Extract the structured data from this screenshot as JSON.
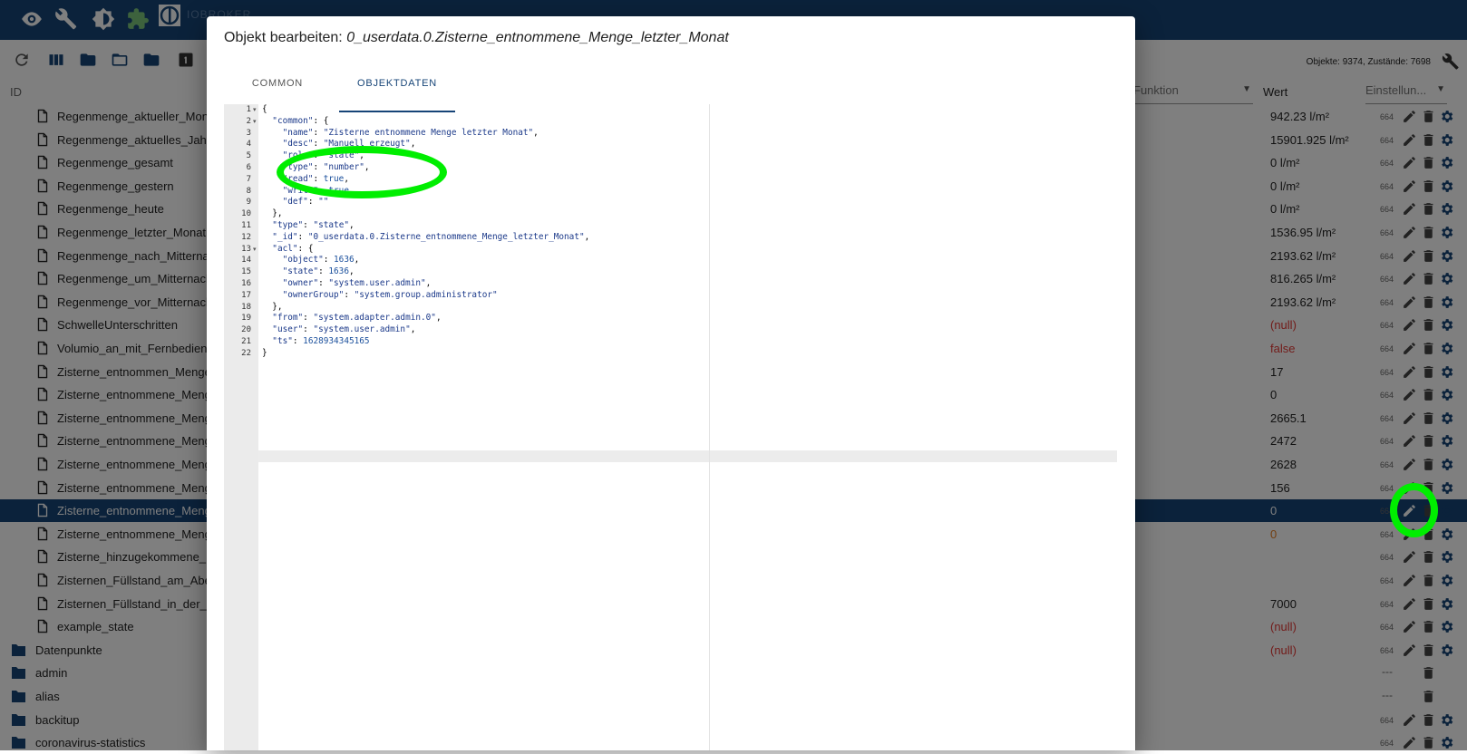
{
  "appbar": {
    "brand": "IOBROKER",
    "icons": [
      "eye-icon",
      "wrench-icon",
      "brightness-icon",
      "puzzle-icon",
      "iobroker-logo-icon"
    ]
  },
  "toolbar": {
    "stats": "Objekte: 9374, Zustände: 7698",
    "icons": [
      "refresh-icon",
      "columns-icon",
      "folder-icon",
      "folder-open-icon",
      "folder-icon",
      "number-one-icon",
      "wrench-icon"
    ]
  },
  "header": {
    "id": "ID",
    "funktion": "Funktion",
    "wert": "Wert",
    "einstellungen": "Einstellun..."
  },
  "rows": [
    {
      "name": "Regenmenge_aktueller_Monat",
      "value": "942.23 l/m²",
      "acl": "664"
    },
    {
      "name": "Regenmenge_aktuelles_Jahr",
      "value": "15901.925 l/m²",
      "acl": "664"
    },
    {
      "name": "Regenmenge_gesamt",
      "value": "0 l/m²",
      "acl": "664"
    },
    {
      "name": "Regenmenge_gestern",
      "value": "0 l/m²",
      "acl": "664"
    },
    {
      "name": "Regenmenge_heute",
      "value": "0 l/m²",
      "acl": "664"
    },
    {
      "name": "Regenmenge_letzter_Monat",
      "value": "1536.95 l/m²",
      "acl": "664"
    },
    {
      "name": "Regenmenge_nach_Mitternacht",
      "value": "2193.62 l/m²",
      "acl": "664"
    },
    {
      "name": "Regenmenge_um_Mitternacht",
      "value": "816.265 l/m²",
      "acl": "664"
    },
    {
      "name": "Regenmenge_vor_Mitternacht",
      "value": "2193.62 l/m²",
      "acl": "664"
    },
    {
      "name": "SchwelleUnterschritten",
      "value": "(null)",
      "acl": "664"
    },
    {
      "name": "Volumio_an_mit_Fernbedienung",
      "value": "false",
      "acl": "664"
    },
    {
      "name": "Zisterne_entnommen_Menge",
      "value": "17",
      "acl": "664"
    },
    {
      "name": "Zisterne_entnommene_Menge",
      "value": "0",
      "acl": "664"
    },
    {
      "name": "Zisterne_entnommene_Menge",
      "value": "2665.1",
      "acl": "664"
    },
    {
      "name": "Zisterne_entnommene_Menge",
      "value": "2472",
      "acl": "664"
    },
    {
      "name": "Zisterne_entnommene_Menge",
      "value": "2628",
      "acl": "664"
    },
    {
      "name": "Zisterne_entnommene_Menge",
      "value": "156",
      "acl": "664"
    },
    {
      "name": "Zisterne_entnommene_Menge",
      "value": "0",
      "acl": "664"
    },
    {
      "name": "Zisterne_entnommene_Menge",
      "value": "0",
      "acl": "664"
    },
    {
      "name": "Zisterne_hinzugekommene_Menge",
      "value": "",
      "acl": "664"
    },
    {
      "name": "Zisternen_Füllstand_am_Abend",
      "value": "",
      "acl": "664"
    },
    {
      "name": "Zisternen_Füllstand_in_der_Früh",
      "value": "7000",
      "acl": "664"
    },
    {
      "name": "example_state",
      "value": "(null)",
      "acl": "664"
    },
    {
      "name": "Datenpunkte",
      "value": "(null)",
      "acl": "664"
    },
    {
      "name": "admin",
      "value": "",
      "acl": "---"
    },
    {
      "name": "alias",
      "value": "",
      "acl": "---"
    },
    {
      "name": "backitup",
      "value": "",
      "acl": "664"
    },
    {
      "name": "coronavirus-statistics",
      "value": "",
      "acl": "664"
    }
  ],
  "dialog": {
    "title_prefix": "Objekt bearbeiten:",
    "title_object": "0_userdata.0.Zisterne_entnommene_Menge_letzter_Monat",
    "tabs": [
      "COMMON",
      "OBJEKTDATEN"
    ],
    "active_tab": "OBJEKTDATEN",
    "code_lines": [
      "{",
      "  \"common\": {",
      "    \"name\": \"Zisterne entnommene Menge letzter Monat\",",
      "    \"desc\": \"Manuell erzeugt\",",
      "    \"role\": \"state\",",
      "    \"type\": \"number\",",
      "    \"read\": true,",
      "    \"write\": true,",
      "    \"def\": \"\"",
      "  },",
      "  \"type\": \"state\",",
      "  \"_id\": \"0_userdata.0.Zisterne_entnommene_Menge_letzter_Monat\",",
      "  \"acl\": {",
      "    \"object\": 1636,",
      "    \"state\": 1636,",
      "    \"owner\": \"system.user.admin\",",
      "    \"ownerGroup\": \"system.group.administrator\"",
      "  },",
      "  \"from\": \"system.adapter.admin.0\",",
      "  \"user\": \"system.user.admin\",",
      "  \"ts\": 1628934345165",
      "}"
    ]
  },
  "annotations": {
    "highlight_color": "#00ee00"
  }
}
